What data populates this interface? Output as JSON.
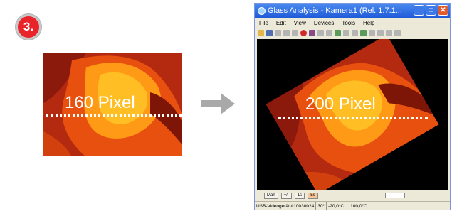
{
  "step": {
    "number": "3."
  },
  "left_image": {
    "label": "160 Pixel"
  },
  "window": {
    "title": "Glass Analysis - Kamera1 (Rel. 1.7.1...",
    "menu": [
      "File",
      "Edit",
      "View",
      "Devices",
      "Tools",
      "Help"
    ],
    "image_label": "200 Pixel",
    "controls": [
      "Man",
      "+/-",
      "1s",
      "5s"
    ],
    "status": {
      "device": "USB-Videogerät #10030024",
      "emissivity": "30°",
      "range": "-20,0°C ... 100,0°C"
    }
  },
  "colors": {
    "badge": "#e8232a",
    "arrow": "#a9a9a9",
    "titlebar": "#2a64dc",
    "thermal_dark": "#9a1d0c",
    "thermal_mid": "#ea5a12",
    "thermal_light": "#ffb21e"
  },
  "icons": [
    "arrow-right-icon",
    "app-icon",
    "minimize-icon",
    "maximize-icon",
    "close-icon"
  ]
}
